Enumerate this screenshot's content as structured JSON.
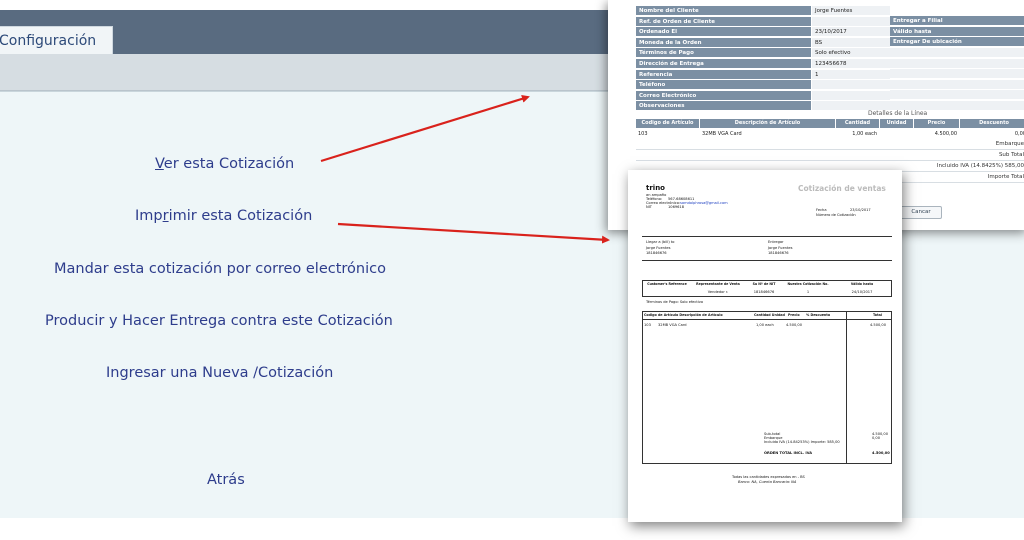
{
  "app": {
    "tab_label": "Configuración",
    "links": [
      {
        "pre": "",
        "u": "V",
        "post": "er esta Cotización"
      },
      {
        "pre": "Imp",
        "u": "r",
        "post": "imir esta Cotización"
      },
      {
        "text": "Mandar esta cotización por correo electrónico"
      },
      {
        "text": "Producir y Hacer Entrega contra este Cotización"
      },
      {
        "text": "Ingresar una Nueva /Cotización"
      },
      {
        "text": "Atrás"
      }
    ],
    "arrow_color": "#d9221c"
  },
  "order_view": {
    "header_fields": [
      {
        "label": "Nombre del Cliente",
        "value": "Jorge Fuentes"
      },
      {
        "label": "Ref. de Orden de Cliente",
        "value": ""
      },
      {
        "label": "Ordenado El",
        "value": "23/10/2017"
      },
      {
        "label": "Moneda de la Orden",
        "value": "BS"
      },
      {
        "label": "Términos de Pago",
        "value": "Solo efectivo"
      },
      {
        "label": "Dirección de Entrega",
        "value": "123456678"
      },
      {
        "label": "Referencia",
        "value": "1"
      },
      {
        "label": "Teléfono",
        "value": ""
      },
      {
        "label": "Correo Electrónico",
        "value": ""
      },
      {
        "label": "Observaciones",
        "value": ""
      }
    ],
    "right_fields": [
      {
        "label": "Entregar a Filial"
      },
      {
        "label": "Válido hasta"
      },
      {
        "label": "Entregar De ubicación"
      }
    ],
    "lines_title": "Detalles de la Línea",
    "line_headers": [
      "Codigo de Artículo",
      "Descripción de Artículo",
      "Cantidad",
      "Unidad",
      "Precio",
      "Descuento"
    ],
    "line_row": [
      "103",
      "32MB VGA Card",
      "1,00 each",
      "",
      "4.500,00",
      "0,00"
    ],
    "summary": [
      "Embarque",
      "Sub Total",
      "Incluido IVA (14.8425%) 585,00",
      "Importe Total"
    ],
    "cancel_label": "Cancar"
  },
  "quote_doc": {
    "company": "trino",
    "company_sub": "an ampafio",
    "phone_label": "Teléfono:",
    "phone": "567-68608611",
    "email_label": "Correo electrónico:",
    "email": "samdolphrosa@gmail.com",
    "nit_label": "NIT",
    "nit": "1069618",
    "title": "Cotización de ventas",
    "date_label": "Fecha",
    "date": "23/10/2017",
    "quote_no_label": "Número de Cotización",
    "bill_to_label": "Llegar a (bill) to",
    "ship_to_label": "Entregar",
    "bill_name": "Jorge Fuentes",
    "bill_addr": "181846676",
    "ship_name": "Jorge Fuentes",
    "ship_addr": "181846676",
    "meta_headers": [
      "Customer's Reference",
      "Representante de Venta",
      "Su Nº de NIT",
      "Nuestra  Cotización No.",
      "Válido hasta"
    ],
    "meta_values": [
      "",
      "Vendedor r.",
      "181846676",
      "1",
      "24/10/2017"
    ],
    "terms": "Términos de Pago: Solo efectivo",
    "item_headers": [
      "Codigo de Artículo Descripción de Artículo",
      "Cantidad Unidad",
      "Precio",
      "% Descuento",
      "Total"
    ],
    "item_row": [
      "103",
      "32MB VGA Card",
      "1,00 each",
      "4.500,00",
      "",
      "4.500,00"
    ],
    "totals": [
      {
        "label": "Sub-total",
        "value": "4.500,00"
      },
      {
        "label": "Embarque",
        "value": "0,00"
      },
      {
        "label": "Incluido IVA (14.84253%) Importe: 585,00",
        "value": ""
      },
      {
        "label": "ÓRDEN TOTAL INCL. IVA",
        "value": "4.500,00"
      }
    ],
    "footer1": "Todas las cantidades expresadas en - BS",
    "footer2": "Banco: NA, Cuenta Bancaria: NA"
  }
}
